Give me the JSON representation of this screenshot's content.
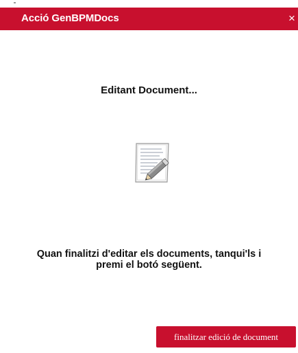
{
  "dialog": {
    "title": "Acció GenBPMDocs",
    "close_label": "×"
  },
  "content": {
    "heading": "Editant Document...",
    "icon": "document-edit-icon",
    "instruction": "Quan finalitzi d'editar els documents, tanqui'ls i premi el botó següent."
  },
  "actions": {
    "finish_label": "finalitzar edició de document"
  },
  "colors": {
    "accent": "#c8102e",
    "background": "#ffffff",
    "text": "#111111"
  }
}
